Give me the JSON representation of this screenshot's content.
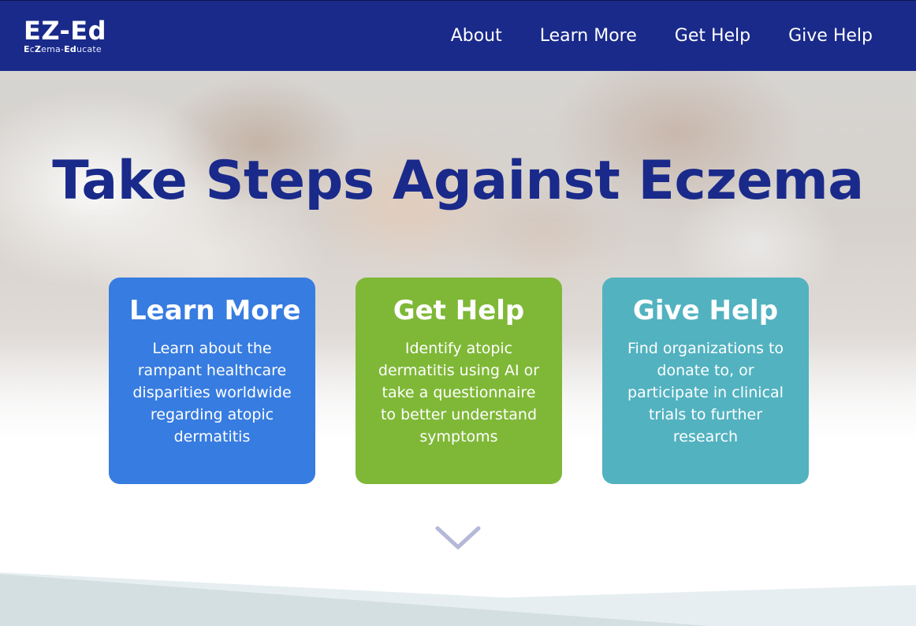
{
  "brand": {
    "name": "EZ-Ed",
    "subtitle_parts": [
      "E",
      "c",
      "Z",
      "ema-",
      "Ed",
      "ucate"
    ]
  },
  "nav": {
    "links": [
      "About",
      "Learn More",
      "Get Help",
      "Give Help"
    ]
  },
  "hero": {
    "title": "Take Steps Against Eczema"
  },
  "cards": [
    {
      "title": "Learn More",
      "text": "Learn about the rampant healthcare disparities worldwide regarding atopic dermatitis",
      "color": "#377ce0"
    },
    {
      "title": "Get Help",
      "text": "Identify atopic dermatitis using AI or take a questionnaire to better understand symptoms",
      "color": "#7fb837"
    },
    {
      "title": "Give Help",
      "text": "Find organizations to donate to, or participate in clinical trials to further research",
      "color": "#52b2c0"
    }
  ],
  "icons": {
    "scroll": "chevron-down-icon"
  },
  "colors": {
    "nav_bg": "#1a2a8a",
    "title": "#1a2a8a",
    "chevron": "#b5b8d8"
  }
}
